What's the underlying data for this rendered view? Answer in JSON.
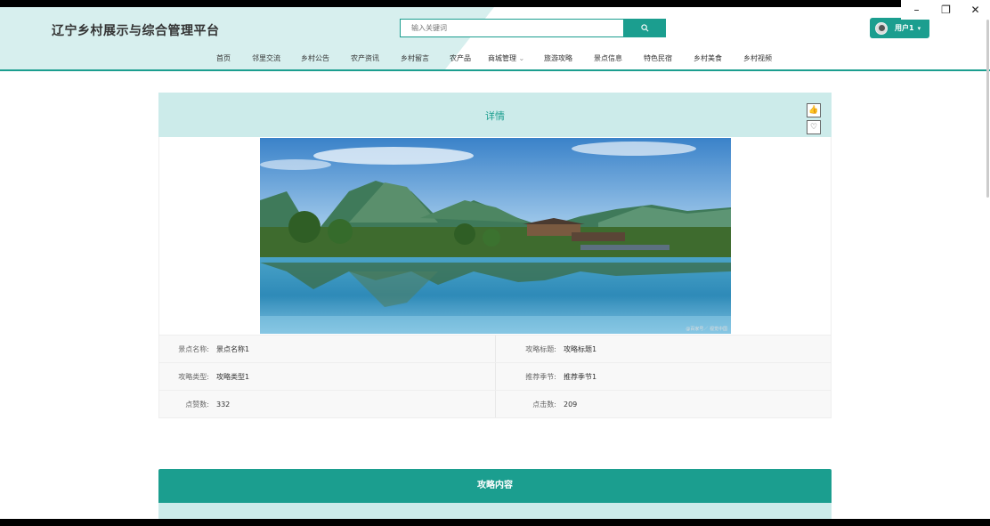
{
  "window": {
    "minimize": "–",
    "restore": "❐",
    "close": "✕"
  },
  "header": {
    "title": "辽宁乡村展示与综合管理平台",
    "search_placeholder": "输入关键词",
    "search_icon": "search-icon",
    "user_label": "用户1",
    "accent": "#1b9e8f"
  },
  "nav": {
    "items": [
      "首页",
      "邻里交流",
      "乡村公告",
      "农产资讯",
      "乡村留言",
      "农产品",
      "商城管理",
      "旅游攻略",
      "景点信息",
      "特色民宿",
      "乡村美食",
      "乡村视频"
    ]
  },
  "detail": {
    "title": "详情",
    "photo_credit": "@百家号／ 视觉中国",
    "fields": [
      {
        "label": "景点名称:",
        "value": "景点名称1"
      },
      {
        "label": "攻略标题:",
        "value": "攻略标题1"
      },
      {
        "label": "攻略类型:",
        "value": "攻略类型1"
      },
      {
        "label": "推荐季节:",
        "value": "推荐季节1"
      },
      {
        "label": "点赞数:",
        "value": "332"
      },
      {
        "label": "点击数:",
        "value": "209"
      }
    ]
  },
  "strategy": {
    "title": "攻略内容"
  }
}
